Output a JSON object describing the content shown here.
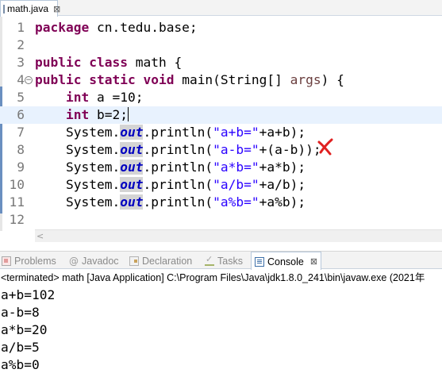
{
  "editor_tab": {
    "filename": "math.java",
    "close_glyph": "⊠"
  },
  "code_lines": [
    {
      "no": "1",
      "segments": [
        {
          "t": "package",
          "c": "kw"
        },
        {
          "t": " cn.tedu.base;",
          "c": ""
        }
      ]
    },
    {
      "no": "2",
      "segments": []
    },
    {
      "no": "3",
      "segments": [
        {
          "t": "public",
          "c": "kw"
        },
        {
          "t": " ",
          "c": ""
        },
        {
          "t": "class",
          "c": "kw"
        },
        {
          "t": " math {",
          "c": ""
        }
      ]
    },
    {
      "no": "4",
      "fold": "−",
      "segments": [
        {
          "t": "public",
          "c": "kw"
        },
        {
          "t": " ",
          "c": ""
        },
        {
          "t": "static",
          "c": "kw"
        },
        {
          "t": " ",
          "c": ""
        },
        {
          "t": "void",
          "c": "kw"
        },
        {
          "t": " main(String[] ",
          "c": ""
        },
        {
          "t": "args",
          "c": "param"
        },
        {
          "t": ") {",
          "c": ""
        }
      ]
    },
    {
      "no": "5",
      "segments": [
        {
          "t": "    ",
          "c": ""
        },
        {
          "t": "int",
          "c": "kw"
        },
        {
          "t": " a =10;",
          "c": ""
        }
      ]
    },
    {
      "no": "6",
      "current": true,
      "caret": true,
      "segments": [
        {
          "t": "    ",
          "c": ""
        },
        {
          "t": "int",
          "c": "kw"
        },
        {
          "t": " b=2;",
          "c": ""
        }
      ]
    },
    {
      "no": "7",
      "segments": [
        {
          "t": "    System.",
          "c": ""
        },
        {
          "t": "out",
          "c": "field"
        },
        {
          "t": ".println(",
          "c": ""
        },
        {
          "t": "\"a+b=\"",
          "c": "str"
        },
        {
          "t": "+a+b);",
          "c": ""
        }
      ]
    },
    {
      "no": "8",
      "segments": [
        {
          "t": "    System.",
          "c": ""
        },
        {
          "t": "out",
          "c": "field"
        },
        {
          "t": ".println(",
          "c": ""
        },
        {
          "t": "\"a-b=\"",
          "c": "str"
        },
        {
          "t": "+(a-b));",
          "c": ""
        }
      ]
    },
    {
      "no": "9",
      "segments": [
        {
          "t": "    System.",
          "c": ""
        },
        {
          "t": "out",
          "c": "field"
        },
        {
          "t": ".println(",
          "c": ""
        },
        {
          "t": "\"a*b=\"",
          "c": "str"
        },
        {
          "t": "+a*b);",
          "c": ""
        }
      ]
    },
    {
      "no": "10",
      "segments": [
        {
          "t": "    System.",
          "c": ""
        },
        {
          "t": "out",
          "c": "field"
        },
        {
          "t": ".println(",
          "c": ""
        },
        {
          "t": "\"a/b=\"",
          "c": "str"
        },
        {
          "t": "+a/b);",
          "c": ""
        }
      ]
    },
    {
      "no": "11",
      "segments": [
        {
          "t": "    System.",
          "c": ""
        },
        {
          "t": "out",
          "c": "field"
        },
        {
          "t": ".println(",
          "c": ""
        },
        {
          "t": "\"a%b=\"",
          "c": "str"
        },
        {
          "t": "+a%b);",
          "c": ""
        }
      ]
    },
    {
      "no": "12",
      "segments": []
    }
  ],
  "annotation": {
    "icon": "red-x-mark-icon",
    "color": "#e02020"
  },
  "hscroll": {
    "left_arrow": "<"
  },
  "view_tabs": [
    {
      "label": "Problems",
      "icon": "problems-icon",
      "active": false
    },
    {
      "label": "Javadoc",
      "icon": "javadoc-icon",
      "active": false
    },
    {
      "label": "Declaration",
      "icon": "declaration-icon",
      "active": false
    },
    {
      "label": "Tasks",
      "icon": "tasks-icon",
      "active": false
    },
    {
      "label": "Console",
      "icon": "console-icon",
      "active": true,
      "close_glyph": "⊠"
    }
  ],
  "console": {
    "header": "<terminated> math [Java Application] C:\\Program Files\\Java\\jdk1.8.0_241\\bin\\javaw.exe (2021年",
    "output": [
      "a+b=102",
      "a-b=8",
      "a*b=20",
      "a/b=5",
      "a%b=0"
    ]
  },
  "colors": {
    "keyword": "#7f0055",
    "string": "#2a00ff",
    "field": "#0000c0",
    "current_line": "#e8f2fe",
    "annotation": "#e02020"
  }
}
